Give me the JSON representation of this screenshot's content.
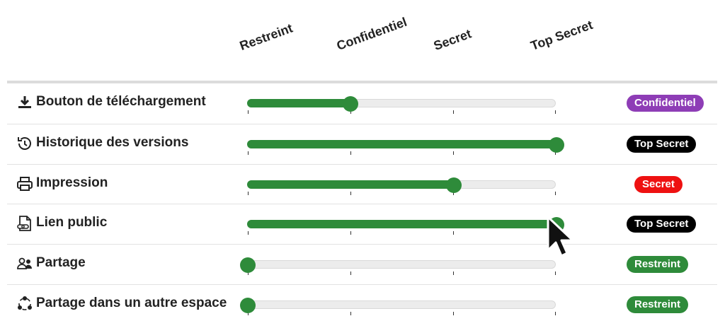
{
  "levels": [
    "Restreint",
    "Confidentiel",
    "Secret",
    "Top Secret"
  ],
  "badge_colors": {
    "Restreint": "#2e8b3a",
    "Confidentiel": "#8e3db6",
    "Secret": "#ee1111",
    "Top Secret": "#000000"
  },
  "rows": [
    {
      "label": "Bouton de téléchargement",
      "icon": "download-icon",
      "level_index": 1,
      "badge": "Confidentiel"
    },
    {
      "label": "Historique des versions",
      "icon": "history-icon",
      "level_index": 3,
      "badge": "Top Secret"
    },
    {
      "label": "Impression",
      "icon": "printer-icon",
      "level_index": 2,
      "badge": "Secret"
    },
    {
      "label": "Lien public",
      "icon": "file-link-icon",
      "level_index": 3,
      "badge": "Top Secret"
    },
    {
      "label": "Partage",
      "icon": "users-icon",
      "level_index": 0,
      "badge": "Restreint"
    },
    {
      "label": "Partage dans un autre espace",
      "icon": "share-network-icon",
      "level_index": 0,
      "badge": "Restreint"
    }
  ],
  "accent_color": "#2e8b3a",
  "cursor_icon": "mouse-pointer-icon"
}
